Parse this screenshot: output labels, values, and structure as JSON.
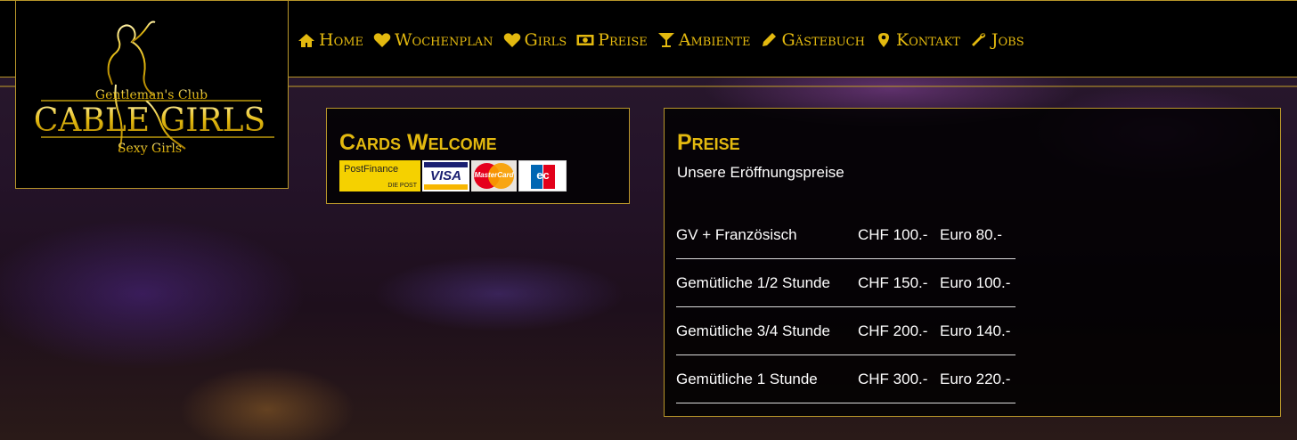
{
  "logo": {
    "tagline_top": "Gentleman's Club",
    "brand": "CABLE GIRLS",
    "tagline_bottom": "Sexy Girls"
  },
  "nav": [
    {
      "label": "Home",
      "icon": "home-icon"
    },
    {
      "label": "Wochenplan",
      "icon": "heart-icon"
    },
    {
      "label": "Girls",
      "icon": "heart-icon"
    },
    {
      "label": "Preise",
      "icon": "money-icon"
    },
    {
      "label": "Ambiente",
      "icon": "cocktail-icon"
    },
    {
      "label": "Gästebuch",
      "icon": "pencil-icon"
    },
    {
      "label": "Kontakt",
      "icon": "map-marker-icon"
    },
    {
      "label": "Jobs",
      "icon": "wrench-icon"
    }
  ],
  "cards": {
    "title": "Cards Welcome",
    "postfinance_label": "PostFinance",
    "postfinance_sub": "DIE POST",
    "visa_label": "VISA",
    "mastercard_label": "MasterCard",
    "ec_label": "ec"
  },
  "preise": {
    "title": "Preise",
    "subtitle": "Unsere Eröffnungspreise",
    "rows": [
      {
        "name": "GV + Französisch",
        "chf": "CHF 100.-",
        "eur": "Euro 80.-"
      },
      {
        "name": "Gemütliche 1/2 Stunde",
        "chf": "CHF 150.-",
        "eur": "Euro 100.-"
      },
      {
        "name": "Gemütliche 3/4 Stunde",
        "chf": "CHF 200.-",
        "eur": "Euro 140.-"
      },
      {
        "name": "Gemütliche 1 Stunde",
        "chf": "CHF 300.-",
        "eur": "Euro 220.-"
      }
    ]
  },
  "colors": {
    "gold": "#e3b90f",
    "border_gold": "#b8962a",
    "panel_bg": "#000000"
  }
}
